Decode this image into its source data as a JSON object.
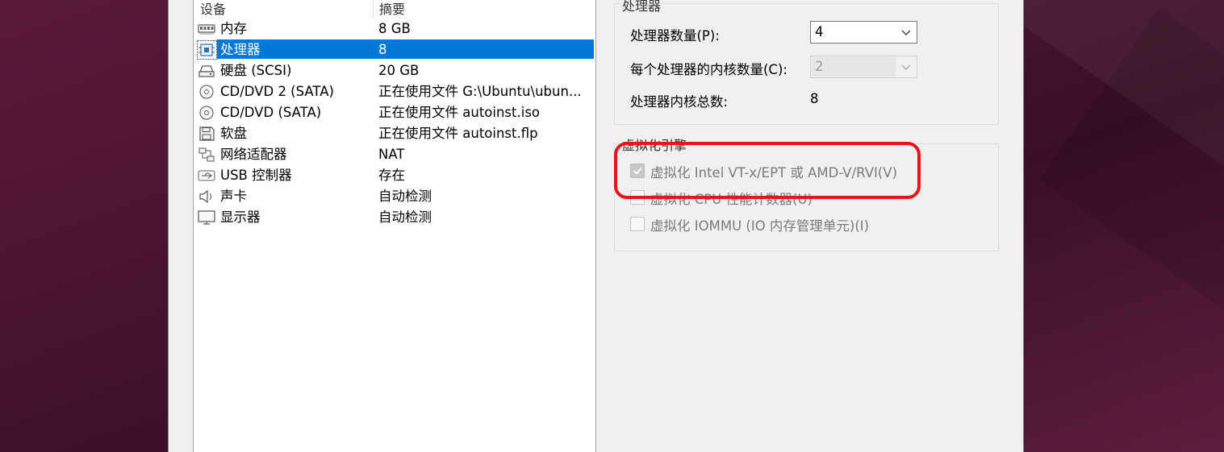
{
  "device_list": {
    "headers": {
      "device": "设备",
      "summary": "摘要"
    },
    "rows": [
      {
        "icon": "memory-icon",
        "name": "内存",
        "summary": "8 GB"
      },
      {
        "icon": "processor-icon",
        "name": "处理器",
        "summary": "8",
        "selected": true
      },
      {
        "icon": "hard-disk-icon",
        "name": "硬盘 (SCSI)",
        "summary": "20 GB"
      },
      {
        "icon": "cd-dvd-icon",
        "name": "CD/DVD 2 (SATA)",
        "summary": "正在使用文件 G:\\Ubuntu\\ubun..."
      },
      {
        "icon": "cd-dvd-icon",
        "name": "CD/DVD (SATA)",
        "summary": "正在使用文件 autoinst.iso"
      },
      {
        "icon": "floppy-icon",
        "name": "软盘",
        "summary": "正在使用文件 autoinst.flp"
      },
      {
        "icon": "network-adapter-icon",
        "name": "网络适配器",
        "summary": "NAT"
      },
      {
        "icon": "usb-icon",
        "name": "USB 控制器",
        "summary": "存在"
      },
      {
        "icon": "sound-icon",
        "name": "声卡",
        "summary": "自动检测"
      },
      {
        "icon": "display-icon",
        "name": "显示器",
        "summary": "自动检测"
      }
    ]
  },
  "processors": {
    "group_title": "处理器",
    "count_label": "处理器数量(P):",
    "count_value": "4",
    "cores_label": "每个处理器的内核数量(C):",
    "cores_value": "2",
    "total_label": "处理器内核总数:",
    "total_value": "8"
  },
  "virtualization": {
    "group_title": "虚拟化引擎",
    "options": [
      {
        "label": "虚拟化 Intel VT-x/EPT 或 AMD-V/RVI(V)",
        "checked": true,
        "enabled": false
      },
      {
        "label": "虚拟化 CPU 性能计数器(U)",
        "checked": false,
        "enabled": false
      },
      {
        "label": "虚拟化 IOMMU (IO 内存管理单元)(I)",
        "checked": false,
        "enabled": false
      }
    ]
  },
  "annotation": {
    "color": "#e8161b",
    "shape": "rounded-rectangle"
  },
  "colors": {
    "selection": "#0078d7",
    "window_bg": "#f0f0f0",
    "desktop_bg": "#4a1430"
  }
}
